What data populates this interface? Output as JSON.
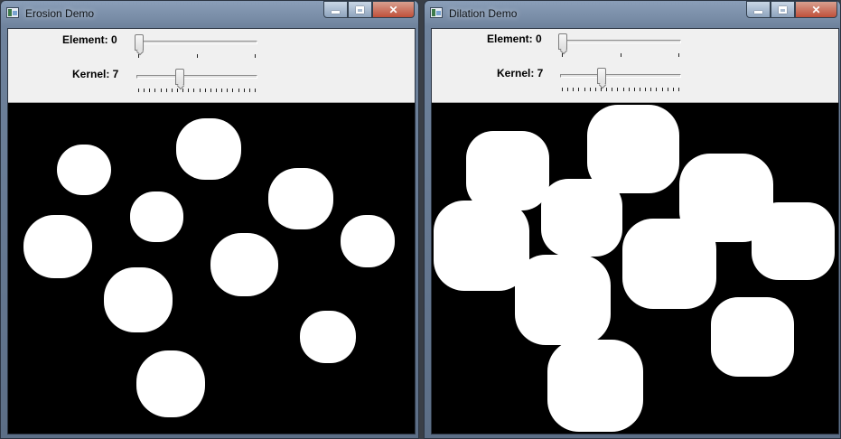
{
  "windows": [
    {
      "title": "Erosion Demo",
      "element_trackbar": {
        "label": "Element: 0",
        "value": 0,
        "max": 2
      },
      "kernel_trackbar": {
        "label": "Kernel: 7",
        "value": 7,
        "max": 21
      },
      "operation": "erosion"
    },
    {
      "title": "Dilation Demo",
      "element_trackbar": {
        "label": "Element: 0",
        "value": 0,
        "max": 2
      },
      "kernel_trackbar": {
        "label": "Kernel: 7",
        "value": 7,
        "max": 21
      },
      "operation": "dilation"
    }
  ],
  "caption_buttons": {
    "minimize": "minimize-icon",
    "maximize": "maximize-icon",
    "close": "close-icon"
  },
  "colors": {
    "blob": "#ffffff",
    "background": "#000000",
    "control_panel": "#f0f0f0"
  }
}
